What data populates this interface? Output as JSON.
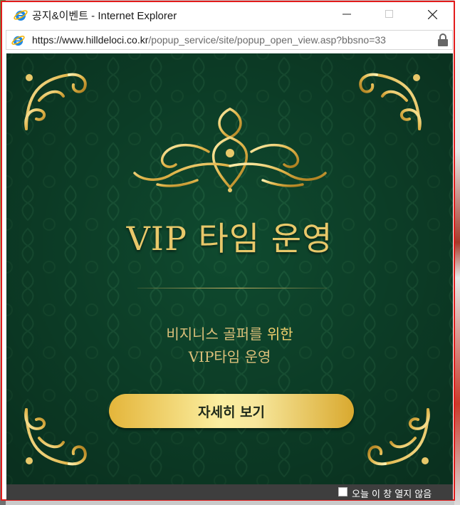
{
  "window": {
    "title": "공지&이벤트 - Internet Explorer",
    "url_scheme_host": "https://www.hilldeloci.co.kr",
    "url_path": "/popup_service/site/popup_open_view.asp?bbsno=33"
  },
  "popup": {
    "heading": "VIP 타임 운영",
    "sub_line1_a": "비지니스 골퍼를 ",
    "sub_line1_b": "위한",
    "sub_line2": "VIP타임 운영",
    "cta_label": "자세히 보기",
    "background_color": "#0f4a2f",
    "gold_color": "#e8c86a"
  },
  "footer": {
    "dont_open_today": "오늘 이 창 열지 않음"
  },
  "icons": [
    "ie-icon",
    "minimize-icon",
    "maximize-icon",
    "close-icon",
    "lock-icon",
    "ornament"
  ]
}
